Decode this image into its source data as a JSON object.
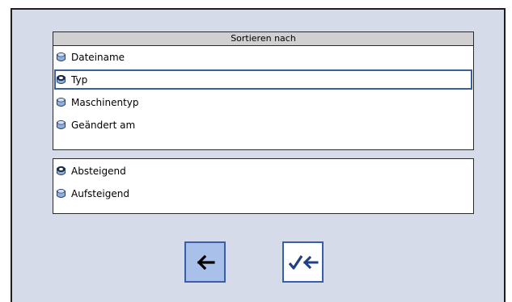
{
  "sort_by": {
    "header": "Sortieren nach",
    "options": [
      {
        "label": "Dateiname",
        "selected": false
      },
      {
        "label": "Typ",
        "selected": true
      },
      {
        "label": "Maschinentyp",
        "selected": false
      },
      {
        "label": "Geändert am",
        "selected": false
      }
    ]
  },
  "order": {
    "options": [
      {
        "label": "Absteigend",
        "selected": true
      },
      {
        "label": "Aufsteigend",
        "selected": false
      }
    ]
  },
  "buttons": {
    "back_icon": "arrow-left-icon",
    "confirm_icon": "check-arrow-left-icon"
  },
  "colors": {
    "dialog_bg": "#d6dbe9",
    "accent": "#3b5ea8",
    "back_button_bg": "#a9c1ea",
    "header_bg": "#d0d0d0"
  }
}
